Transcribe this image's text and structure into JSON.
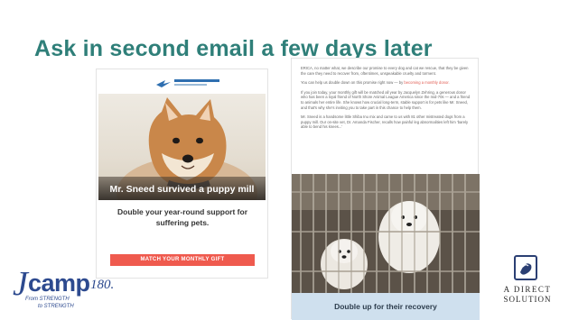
{
  "slide": {
    "title": "Ask in second email a few days later"
  },
  "email_left": {
    "logo_icon": "animal-league-logo",
    "photo_caption": "Mr. Sneed survived a puppy mill",
    "body": "Double your year-round support for suffering pets.",
    "cta_label": "MATCH YOUR MONTHLY GIFT"
  },
  "email_right": {
    "paragraphs": [
      "ERICA, no matter what, we describe our promise to every dog and cat we rescue, that they be given the care they need to recover from, oftentimes, unspeakable cruelty and torment.",
      "You can help us double down on this promise right now — by",
      "If you join today, your monthly gift will be matched all year by Jacquelyn Zehring, a generous donor who has been a loyal friend of North Shore Animal League America since the mid-70s — and a friend to animals her entire life. She knows how crucial long-term, stable support is for pets like Mr. Sneed, and that's why she's inviting you to take part in this chance to help them.",
      "Mr. Sneed is a handsome little Shiba Inu mix and came to us with 81 other mistreated dogs from a puppy mill. Our on-site vet, Dr. Amanda Fischer, recalls how painful leg abnormalities left him 'barely able to bend his knees...'"
    ],
    "link_text": "becoming a monthly donor.",
    "band_label": "Double up for their recovery"
  },
  "logos": {
    "jcamp": {
      "j": "J",
      "camp": "camp",
      "number": "180.",
      "tag_from": "From STRENGTH",
      "tag_to": "to STRENGTH"
    },
    "direct_solution": {
      "line1": "A DIRECT",
      "line2": "SOLUTION"
    }
  },
  "colors": {
    "title": "#2f7f79",
    "cta": "#ef5a4e",
    "band": "#cfe0ee",
    "logo_blue": "#2d4a8f"
  }
}
